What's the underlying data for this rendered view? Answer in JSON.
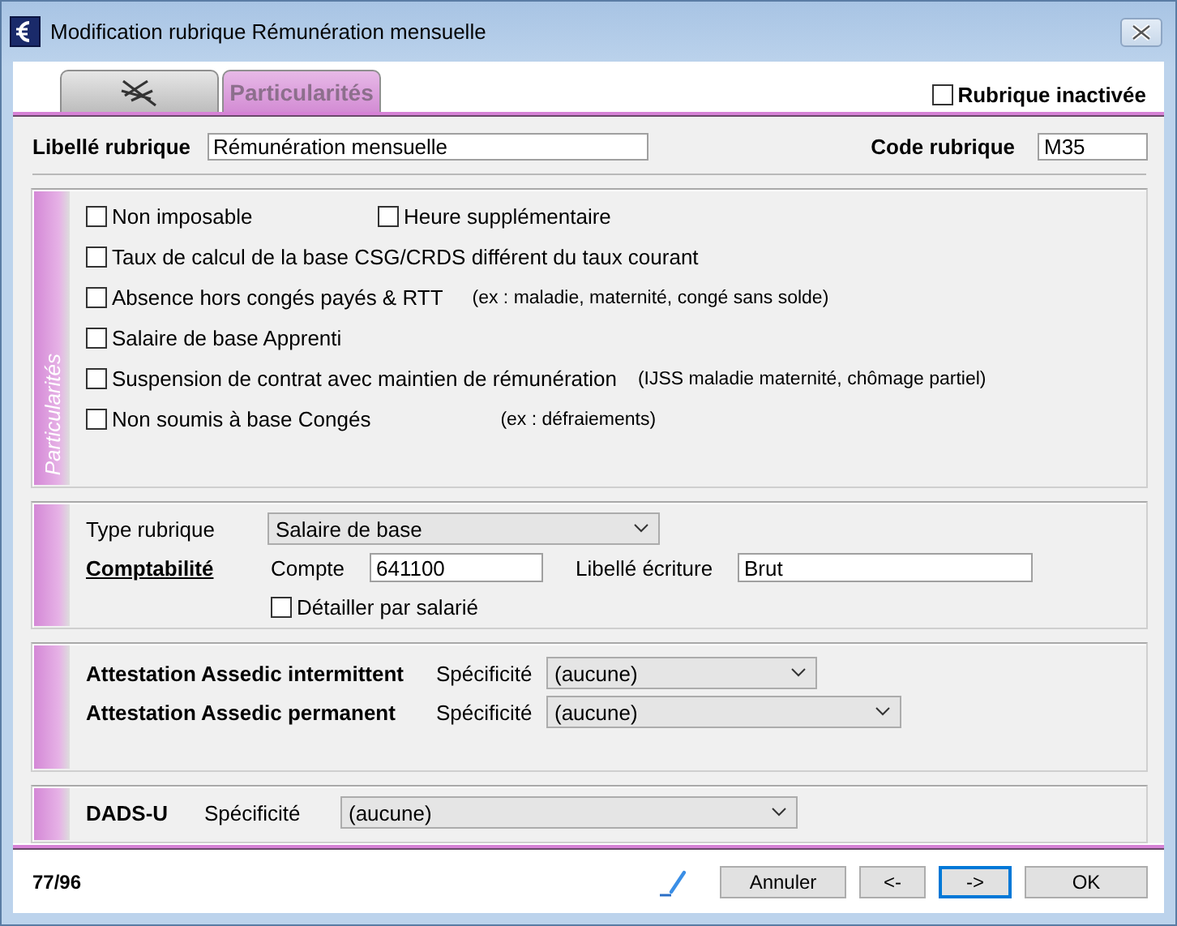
{
  "window": {
    "title": "Modification rubrique Rémunération mensuelle"
  },
  "tabs": [
    {
      "kind": "icon",
      "selected": false
    },
    {
      "kind": "text",
      "label": "Particularités",
      "selected": true
    }
  ],
  "inactive": {
    "label": "Rubrique inactivée",
    "checked": false
  },
  "libelle": {
    "label": "Libellé rubrique",
    "value": "Rémunération mensuelle"
  },
  "code": {
    "label": "Code rubrique",
    "value": "M35"
  },
  "particularites": {
    "title": "Particularités",
    "rows": [
      {
        "items": [
          {
            "label": "Non imposable",
            "checked": false
          },
          {
            "label": "Heure supplémentaire",
            "checked": false
          }
        ]
      },
      {
        "items": [
          {
            "label": "Taux de calcul de la base CSG/CRDS différent du taux courant",
            "checked": false
          }
        ]
      },
      {
        "items": [
          {
            "label": "Absence hors congés payés & RTT",
            "checked": false
          }
        ],
        "note": "(ex : maladie, maternité, congé sans solde)"
      },
      {
        "items": [
          {
            "label": "Salaire de base Apprenti",
            "checked": false
          }
        ]
      },
      {
        "items": [
          {
            "label": "Suspension de contrat avec maintien de rémunération",
            "checked": false
          }
        ],
        "note": "(IJSS maladie maternité, chômage partiel)"
      },
      {
        "items": [
          {
            "label": "Non soumis à base Congés",
            "checked": false
          }
        ],
        "note": "(ex : défraiements)"
      }
    ]
  },
  "type_rubrique": {
    "label": "Type rubrique",
    "value": "Salaire de base"
  },
  "comptabilite": {
    "title": "Comptabilité",
    "compte_label": "Compte",
    "compte": "641100",
    "ecriture_label": "Libellé écriture",
    "ecriture": "Brut",
    "detail": {
      "label": "Détailler par salarié",
      "checked": false
    }
  },
  "attestations": [
    {
      "label": "Attestation Assedic intermittent",
      "spec_label": "Spécificité",
      "value": "(aucune)"
    },
    {
      "label": "Attestation Assedic permanent",
      "spec_label": "Spécificité",
      "value": "(aucune)"
    }
  ],
  "dads": {
    "label": "DADS-U",
    "spec_label": "Spécificité",
    "value": "(aucune)"
  },
  "footer": {
    "counter": "77/96",
    "buttons": [
      {
        "label": "Annuler",
        "focused": false
      },
      {
        "label": "<-",
        "focused": false
      },
      {
        "label": "->",
        "focused": true
      },
      {
        "label": "OK",
        "focused": false
      }
    ]
  }
}
